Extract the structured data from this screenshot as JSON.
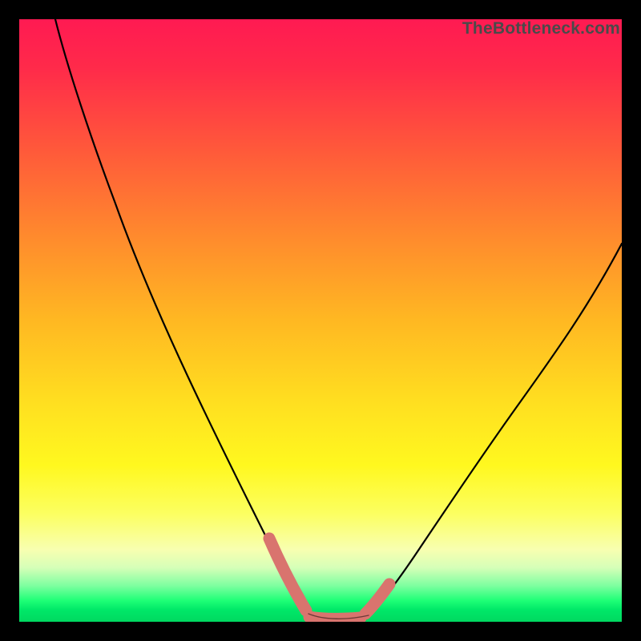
{
  "watermark": "TheBottleneck.com",
  "chart_data": {
    "type": "line",
    "title": "",
    "xlabel": "",
    "ylabel": "",
    "xlim": [
      0,
      100
    ],
    "ylim": [
      0,
      100
    ],
    "grid": false,
    "legend": false,
    "series": [
      {
        "name": "left-branch",
        "x": [
          6,
          10,
          15,
          20,
          25,
          30,
          35,
          40,
          43,
          46,
          48
        ],
        "y": [
          100,
          88,
          74,
          61,
          48,
          36,
          25,
          14,
          8,
          3,
          0.8
        ]
      },
      {
        "name": "valley-floor",
        "x": [
          48,
          50,
          53,
          56,
          58
        ],
        "y": [
          0.8,
          0.4,
          0.4,
          0.6,
          1.0
        ]
      },
      {
        "name": "right-branch",
        "x": [
          58,
          62,
          68,
          75,
          82,
          90,
          100
        ],
        "y": [
          1.0,
          4,
          11,
          22,
          34,
          47,
          63
        ]
      }
    ],
    "highlights": [
      {
        "name": "left-highlight",
        "x_range": [
          41,
          48
        ],
        "color": "#d9746e"
      },
      {
        "name": "floor-highlight",
        "x_range": [
          48,
          57
        ],
        "color": "#d9746e"
      },
      {
        "name": "right-highlight",
        "x_range": [
          57,
          61
        ],
        "color": "#d9746e"
      }
    ],
    "background_gradient": {
      "stops": [
        {
          "pos": 0.0,
          "color": "#ff1a52"
        },
        {
          "pos": 0.5,
          "color": "#ffb822"
        },
        {
          "pos": 0.74,
          "color": "#fff81f"
        },
        {
          "pos": 0.94,
          "color": "#7effa0"
        },
        {
          "pos": 1.0,
          "color": "#00d860"
        }
      ]
    }
  }
}
